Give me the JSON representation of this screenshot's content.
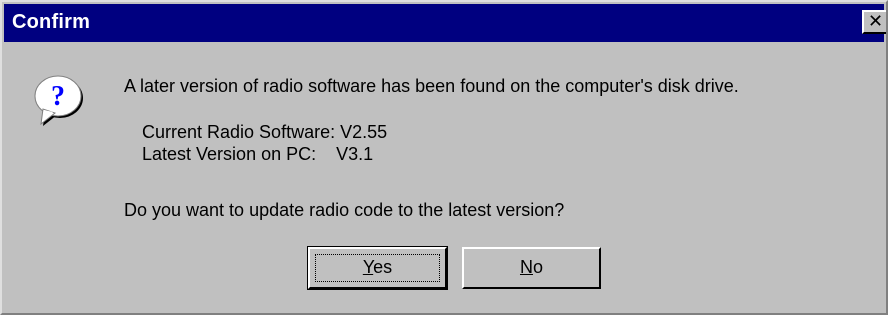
{
  "window": {
    "title": "Confirm",
    "close_glyph": "✕"
  },
  "icon": {
    "name": "question-icon",
    "glyph": "?"
  },
  "message": {
    "main": "A later version of radio software has been found on the computer's disk drive.",
    "current_label": "Current Radio Software:",
    "current_value": "V2.55",
    "latest_label": "Latest Version on PC:",
    "latest_value": "V3.1",
    "question": "Do you want to update radio code to the latest version?"
  },
  "buttons": {
    "yes_hotkey": "Y",
    "yes_rest": "es",
    "no_hotkey": "N",
    "no_rest": "o"
  },
  "colors": {
    "titlebar": "#000080",
    "face": "#c0c0c0",
    "icon_blue": "#0000ff"
  }
}
